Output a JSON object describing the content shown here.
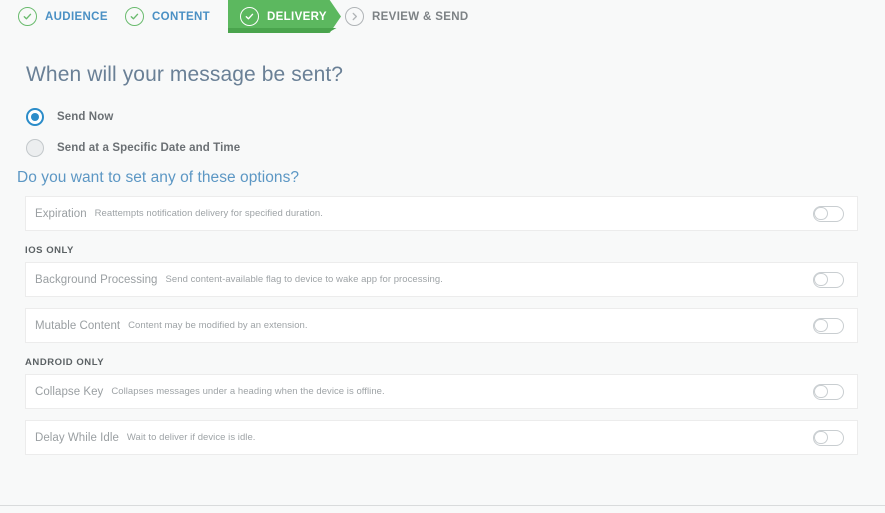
{
  "steps": [
    {
      "label": "AUDIENCE",
      "icon": "check-circle-icon",
      "state": "complete"
    },
    {
      "label": "CONTENT",
      "icon": "check-circle-icon",
      "state": "complete"
    },
    {
      "label": "DELIVERY",
      "icon": "check-circle-icon",
      "state": "active"
    },
    {
      "label": "REVIEW & SEND",
      "icon": "chevron-right-circle-icon",
      "state": "upcoming"
    }
  ],
  "main": {
    "page_title": "When will your message be sent?",
    "schedule_options": [
      {
        "label": "Send Now",
        "selected": true
      },
      {
        "label": "Send at a Specific Date and Time",
        "selected": false
      }
    ],
    "options_title": "Do you want to set any of these options?",
    "groups": [
      {
        "label": "",
        "rows": [
          {
            "name": "Expiration",
            "description": "Reattempts notification delivery for specified duration.",
            "toggle": "off"
          }
        ]
      },
      {
        "label": "IOS ONLY",
        "rows": [
          {
            "name": "Background Processing",
            "description": "Send content-available flag to device to wake app for processing.",
            "toggle": "off"
          },
          {
            "name": "Mutable Content",
            "description": "Content may be modified by an extension.",
            "toggle": "off"
          }
        ]
      },
      {
        "label": "ANDROID ONLY",
        "rows": [
          {
            "name": "Collapse Key",
            "description": "Collapses messages under a heading when the device is offline.",
            "toggle": "off"
          },
          {
            "name": "Delay While Idle",
            "description": "Wait to deliver if device is idle.",
            "toggle": "off"
          }
        ]
      }
    ]
  },
  "colors": {
    "active_step_green": "#5cb85f",
    "active_step_green_dark": "#4aa44d",
    "step_link_blue": "#4a90c4",
    "radio_blue": "#2b8cc9",
    "title_blue_gray": "#6a8096",
    "section_blue": "#5c97c4",
    "page_background": "#f8f9f9"
  }
}
